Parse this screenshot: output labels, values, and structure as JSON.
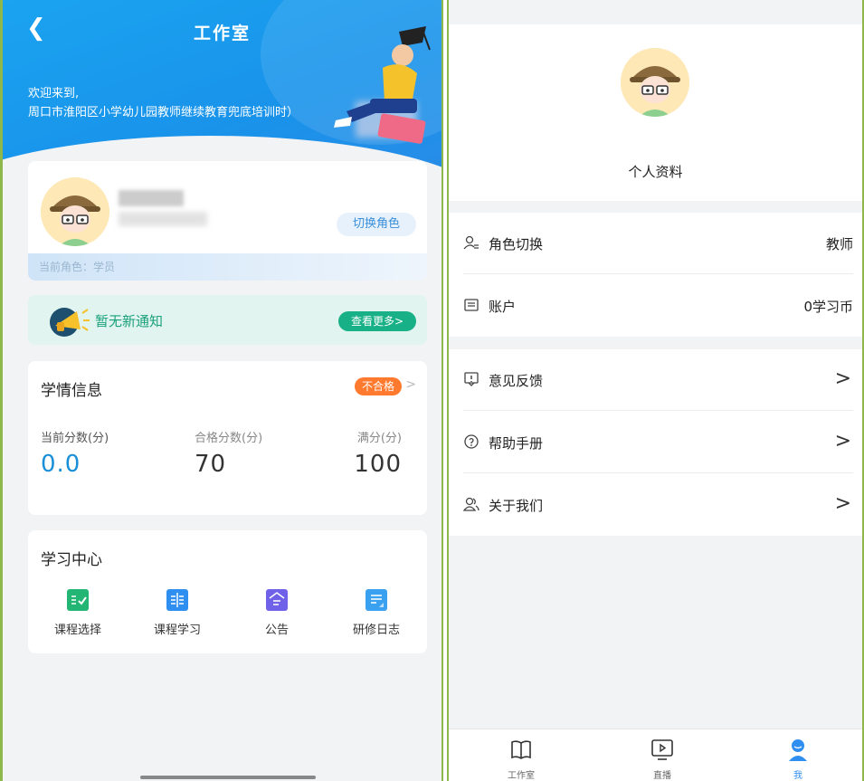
{
  "left": {
    "header": {
      "title": "工作室",
      "welcome": "欢迎来到,",
      "school": "周口市淮阳区小学幼儿园教师继续教育兜底培训时）"
    },
    "profile": {
      "switch_role_label": "切换角色",
      "current_role": "当前角色：学员"
    },
    "notice": {
      "text": "暂无新通知",
      "more_label": "查看更多>"
    },
    "study_info": {
      "title": "学情信息",
      "status_badge": "不合格",
      "chevron": ">",
      "scores": [
        {
          "label": "当前分数(分)",
          "value": "0.0",
          "color": "#1a8fd8"
        },
        {
          "label": "合格分数(分)",
          "value": "70",
          "color": "#333333"
        },
        {
          "label": "满分(分)",
          "value": "100",
          "color": "#333333"
        }
      ]
    },
    "learning_center": {
      "title": "学习中心",
      "items": [
        {
          "label": "课程选择",
          "icon": "course-select-icon",
          "color": "#22b573"
        },
        {
          "label": "课程学习",
          "icon": "course-study-icon",
          "color": "#2f8ff0"
        },
        {
          "label": "公告",
          "icon": "announcement-icon",
          "color": "#6f62e8"
        },
        {
          "label": "研修日志",
          "icon": "journal-icon",
          "color": "#3aa0f0"
        }
      ]
    }
  },
  "right": {
    "profile_label": "个人资料",
    "group1": [
      {
        "label": "角色切换",
        "value": "教师",
        "icon": "user-switch-icon"
      },
      {
        "label": "账户",
        "value": "0学习币",
        "icon": "account-icon"
      }
    ],
    "group2": [
      {
        "label": "意见反馈",
        "icon": "feedback-icon"
      },
      {
        "label": "帮助手册",
        "icon": "help-icon"
      },
      {
        "label": "关于我们",
        "icon": "about-icon"
      }
    ],
    "chevron": ">",
    "tabs": [
      {
        "label": "工作室",
        "icon": "book-icon",
        "active": false
      },
      {
        "label": "直播",
        "icon": "live-icon",
        "active": false
      },
      {
        "label": "我",
        "icon": "me-icon",
        "active": true
      }
    ],
    "accent": "#2f8ff0"
  }
}
